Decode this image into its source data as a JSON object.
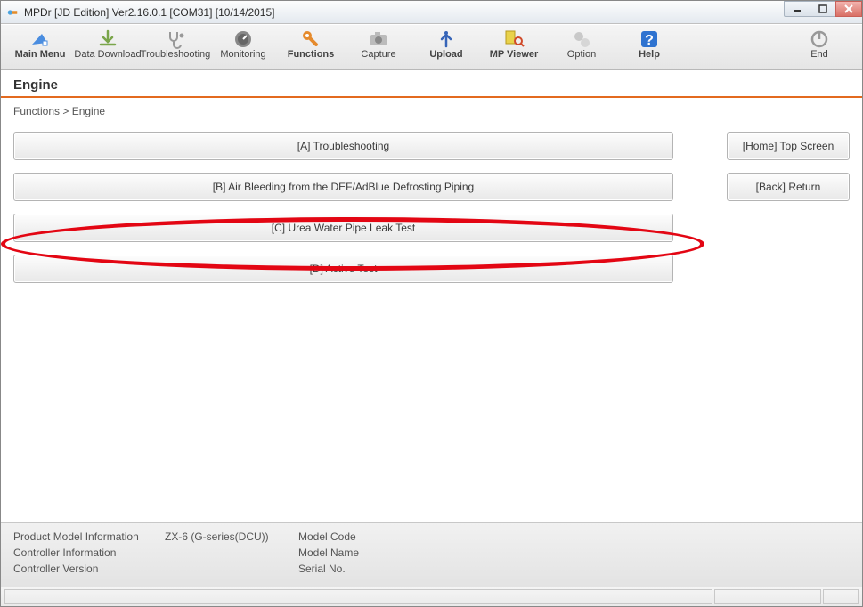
{
  "window": {
    "title": "MPDr [JD Edition] Ver2.16.0.1 [COM31] [10/14/2015]"
  },
  "toolbar": {
    "main_menu": "Main Menu",
    "data_download": "Data Download",
    "troubleshooting": "Troubleshooting",
    "monitoring": "Monitoring",
    "functions": "Functions",
    "capture": "Capture",
    "upload": "Upload",
    "mp_viewer": "MP Viewer",
    "option": "Option",
    "help": "Help",
    "end": "End"
  },
  "section": {
    "title": "Engine"
  },
  "breadcrumb": "Functions  >  Engine",
  "buttons": {
    "a": "[A] Troubleshooting",
    "b": "[B] Air Bleeding from the DEF/AdBlue Defrosting Piping",
    "c": "[C] Urea Water Pipe Leak Test",
    "d": "[D] Active Test",
    "home": "[Home] Top Screen",
    "back": "[Back] Return"
  },
  "footer": {
    "row1": {
      "label": "Product Model Information",
      "value": "ZX-6 (G-series(DCU))",
      "label2": "Model Code"
    },
    "row2": {
      "label": "Controller Information",
      "value": "",
      "label2": "Model Name"
    },
    "row3": {
      "label": "Controller Version",
      "value": "",
      "label2": "Serial No."
    }
  }
}
